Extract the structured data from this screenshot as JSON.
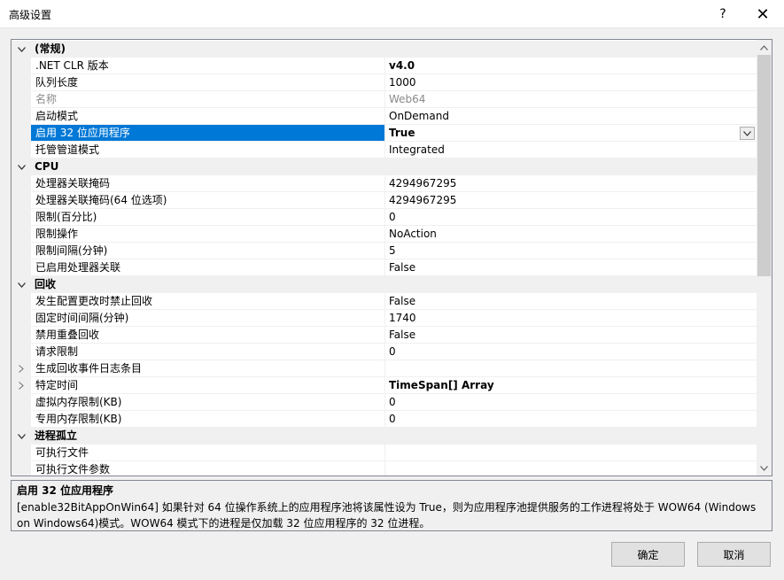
{
  "window": {
    "title": "高级设置",
    "help_label": "?",
    "close_label": "✕"
  },
  "grid": {
    "rows": [
      {
        "kind": "category",
        "expander": "expanded",
        "label": "(常规)"
      },
      {
        "kind": "prop",
        "name": ".NET CLR 版本",
        "value": "v4.0",
        "bold": true
      },
      {
        "kind": "prop",
        "name": "队列长度",
        "value": "1000"
      },
      {
        "kind": "prop",
        "name": "名称",
        "value": "Web64",
        "disabled": true
      },
      {
        "kind": "prop",
        "name": "启动模式",
        "value": "OnDemand"
      },
      {
        "kind": "prop",
        "name": "启用 32 位应用程序",
        "value": "True",
        "selected": true,
        "dropdown": true
      },
      {
        "kind": "prop",
        "name": "托管管道模式",
        "value": "Integrated"
      },
      {
        "kind": "category",
        "expander": "expanded",
        "label": "CPU"
      },
      {
        "kind": "prop",
        "name": "处理器关联掩码",
        "value": "4294967295"
      },
      {
        "kind": "prop",
        "name": "处理器关联掩码(64 位选项)",
        "value": "4294967295"
      },
      {
        "kind": "prop",
        "name": "限制(百分比)",
        "value": "0"
      },
      {
        "kind": "prop",
        "name": "限制操作",
        "value": "NoAction"
      },
      {
        "kind": "prop",
        "name": "限制间隔(分钟)",
        "value": "5"
      },
      {
        "kind": "prop",
        "name": "已启用处理器关联",
        "value": "False"
      },
      {
        "kind": "category",
        "expander": "expanded",
        "label": "回收"
      },
      {
        "kind": "prop",
        "name": "发生配置更改时禁止回收",
        "value": "False"
      },
      {
        "kind": "prop",
        "name": "固定时间间隔(分钟)",
        "value": "1740"
      },
      {
        "kind": "prop",
        "name": "禁用重叠回收",
        "value": "False"
      },
      {
        "kind": "prop",
        "name": "请求限制",
        "value": "0"
      },
      {
        "kind": "prop",
        "name": "生成回收事件日志条目",
        "value": "",
        "expander": "collapsed"
      },
      {
        "kind": "prop",
        "name": "特定时间",
        "value": "TimeSpan[] Array",
        "bold": true,
        "expander": "collapsed"
      },
      {
        "kind": "prop",
        "name": "虚拟内存限制(KB)",
        "value": "0"
      },
      {
        "kind": "prop",
        "name": "专用内存限制(KB)",
        "value": "0"
      },
      {
        "kind": "category",
        "expander": "expanded",
        "label": "进程孤立"
      },
      {
        "kind": "prop",
        "name": "可执行文件",
        "value": ""
      },
      {
        "kind": "prop",
        "name": "可执行文件参数",
        "value": ""
      }
    ]
  },
  "description": {
    "title": "启用 32 位应用程序",
    "body": "[enable32BitAppOnWin64] 如果针对 64 位操作系统上的应用程序池将该属性设为 True，则为应用程序池提供服务的工作进程将处于 WOW64 (Windows on Windows64)模式。WOW64 模式下的进程是仅加载 32 位应用程序的 32 位进程。"
  },
  "buttons": {
    "ok": "确定",
    "cancel": "取消"
  },
  "colors": {
    "selection": "#0078d7",
    "category_bg": "#f0f0f0"
  }
}
